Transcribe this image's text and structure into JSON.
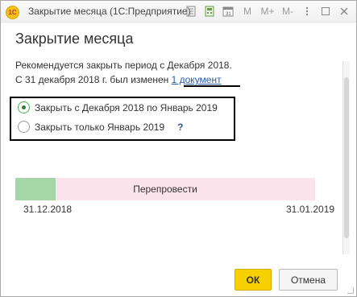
{
  "window": {
    "title": "Закрытие месяца  (1С:Предприятие)",
    "logo_text": "1С",
    "toolbar": {
      "m_label": "M",
      "m_plus_label": "M+",
      "m_minus_label": "M-"
    }
  },
  "form": {
    "title": "Закрытие месяца",
    "line1": "Рекомендуется закрыть период с Декабря 2018.",
    "line2_prefix": "С 31 декабря 2018 г. был изменен ",
    "line2_link": "1 документ"
  },
  "options": {
    "selected": 0,
    "items": [
      {
        "label": "Закрыть с Декабря 2018 по Январь 2019"
      },
      {
        "label": "Закрыть только Январь 2019"
      }
    ],
    "help": "?"
  },
  "progress": {
    "label": "Перепровести",
    "fraction": 0.135,
    "start_date": "31.12.2018",
    "end_date": "31.01.2019",
    "fill_color": "#a5d6a7",
    "track_color": "#fce4ec"
  },
  "buttons": {
    "ok": "ОК",
    "cancel": "Отмена"
  }
}
